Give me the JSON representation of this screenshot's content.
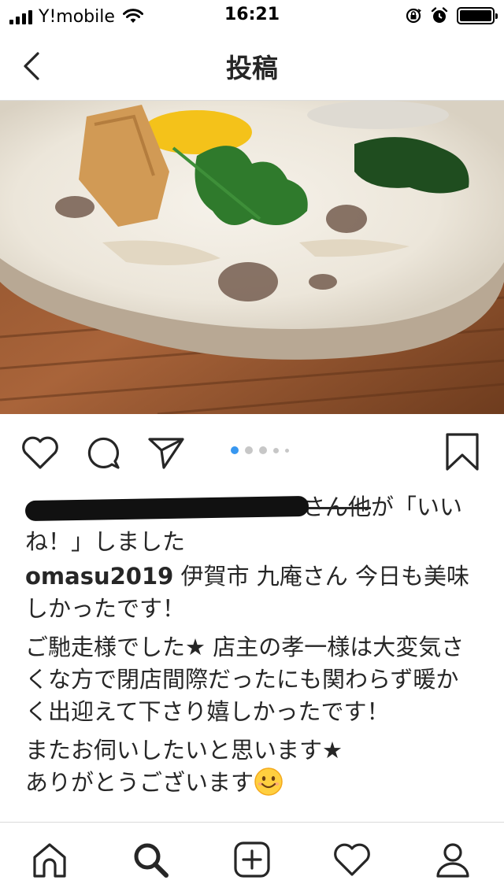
{
  "status_bar": {
    "carrier": "Y!mobile",
    "time": "16:21",
    "icons": [
      "signal-icon",
      "wifi-icon",
      "orientation-lock-icon",
      "alarm-icon",
      "battery-icon"
    ]
  },
  "nav": {
    "title": "投稿",
    "back_icon": "chevron-left-icon"
  },
  "post": {
    "photo_alt": "",
    "carousel": {
      "count": 5,
      "active_index": 0
    },
    "actions": [
      "heart-icon",
      "comment-icon",
      "share-icon",
      "bookmark-icon"
    ],
    "likes": {
      "redacted_name_suffix": "さん他",
      "text_line1": "が「いい",
      "text_line2": "ね！」しました"
    },
    "caption": {
      "username": "omasu2019",
      "line1": " 伊賀市 九庵さん 今日も美味しかったです！",
      "para2": "ご馳走様でした★ 店主の孝一様は大変気さくな方で閉店間際だったにも関わらず暖かく出迎えて下さり嬉しかったです！",
      "para3_line1": "またお伺いしたいと思います★",
      "para3_line2": "ありがとうございます",
      "emoji": "smiling-face-emoji"
    }
  },
  "tab_bar": {
    "items": [
      "home-icon",
      "search-icon",
      "add-post-icon",
      "activity-heart-icon",
      "profile-icon"
    ],
    "active": "search-icon"
  }
}
